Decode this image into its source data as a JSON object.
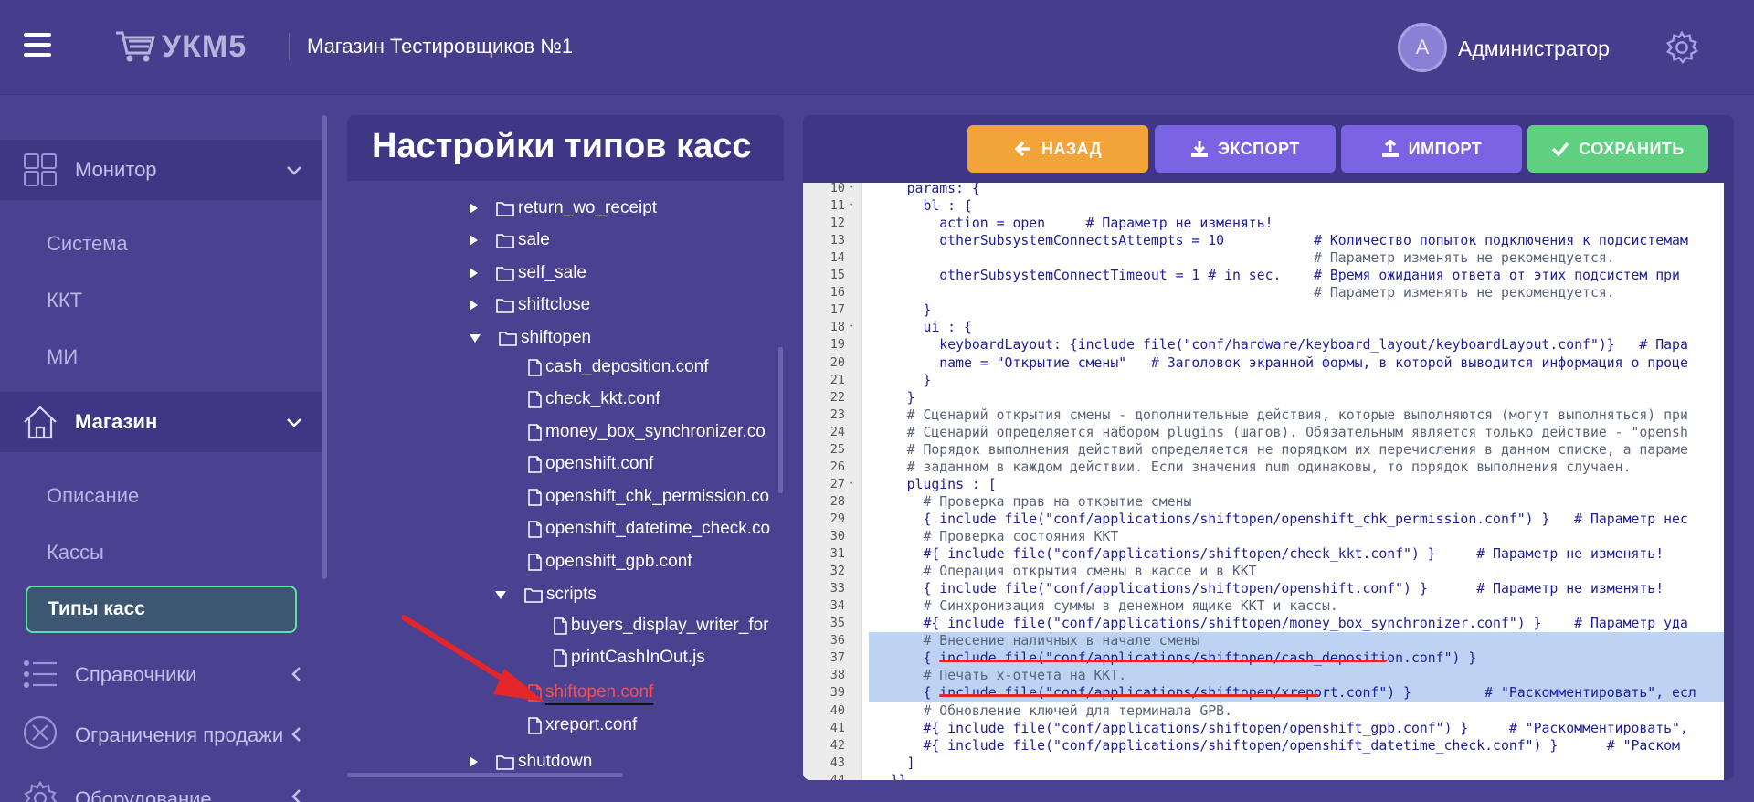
{
  "header": {
    "logo_text": "УКМ5",
    "store_name": "Магазин Тестировщиков №1",
    "avatar_letter": "А",
    "user_name": "Администратор"
  },
  "sidebar": {
    "monitor": "Монитор",
    "monitor_items": [
      "Система",
      "ККТ",
      "МИ"
    ],
    "shop": "Магазин",
    "shop_items": [
      "Описание",
      "Кассы"
    ],
    "shop_active": "Типы касс",
    "directories": "Справочники",
    "sale_limits": "Ограничения продажи",
    "equipment": "Оборудование"
  },
  "tree": {
    "title": "Настройки типов касс",
    "rows": [
      {
        "type": "folder",
        "state": "collapsed",
        "name": "return_wo_receipt"
      },
      {
        "type": "folder",
        "state": "collapsed",
        "name": "sale"
      },
      {
        "type": "folder",
        "state": "collapsed",
        "name": "self_sale"
      },
      {
        "type": "folder",
        "state": "collapsed",
        "name": "shiftclose"
      },
      {
        "type": "folder",
        "state": "expanded",
        "name": "shiftopen"
      },
      {
        "type": "file",
        "name": "cash_deposition.conf"
      },
      {
        "type": "file",
        "name": "check_kkt.conf"
      },
      {
        "type": "file",
        "name": "money_box_synchronizer.co"
      },
      {
        "type": "file",
        "name": "openshift.conf"
      },
      {
        "type": "file",
        "name": "openshift_chk_permission.co"
      },
      {
        "type": "file",
        "name": "openshift_datetime_check.co"
      },
      {
        "type": "file",
        "name": "openshift_gpb.conf"
      },
      {
        "type": "folder",
        "state": "expanded",
        "name": "scripts"
      },
      {
        "type": "file",
        "name": "buyers_display_writer_for"
      },
      {
        "type": "file",
        "name": "printCashInOut.js"
      },
      {
        "type": "file",
        "name": "shiftopen.conf",
        "highlight": true
      },
      {
        "type": "file",
        "name": "xreport.conf"
      },
      {
        "type": "folder",
        "state": "collapsed",
        "name": "shutdown"
      }
    ]
  },
  "toolbar": {
    "back": "НАЗАД",
    "export": "ЭКСПОРТ",
    "import": "ИМПОРТ",
    "save": "СОХРАНИТЬ"
  },
  "editor": {
    "lines": [
      {
        "n": "10",
        "fold": true,
        "text": "    params: {"
      },
      {
        "n": "11",
        "fold": true,
        "text": "      bl : {"
      },
      {
        "n": "12",
        "text": "        action = open     # Параметр не изменять!"
      },
      {
        "n": "13",
        "text": "        otherSubsystemConnectsAttempts = 10           # Количество попыток подключения к подсистемам"
      },
      {
        "n": "14",
        "text": "                                                      # Параметр изменять не рекомендуется."
      },
      {
        "n": "15",
        "text": "        otherSubsystemConnectTimeout = 1 # in sec.    # Время ожидания ответа от этих подсистем при"
      },
      {
        "n": "16",
        "text": "                                                      # Параметр изменять не рекомендуется."
      },
      {
        "n": "17",
        "text": "      }"
      },
      {
        "n": "18",
        "fold": true,
        "text": "      ui : {"
      },
      {
        "n": "19",
        "text": "        keyboardLayout: {include file(\"conf/hardware/keyboard_layout/keyboardLayout.conf\")}   # Пара"
      },
      {
        "n": "20",
        "text": "        name = \"Открытие смены\"   # Заголовок экранной формы, в которой выводится информация о проце"
      },
      {
        "n": "21",
        "text": "      }"
      },
      {
        "n": "22",
        "text": "    }"
      },
      {
        "n": "23",
        "text": "    # Сценарий открытия смены - дополнительные действия, которые выполняются (могут выполняться) при"
      },
      {
        "n": "24",
        "text": "    # Сценарий определяется набором plugins (шагов). Обязательным является только действие - \"opensh"
      },
      {
        "n": "25",
        "text": "    # Порядок выполнения действий определяется не порядком их перечисления в данном списке, а параме"
      },
      {
        "n": "26",
        "text": "    # заданном в каждом действии. Если значения num одинаковы, то порядок выполнения случаен."
      },
      {
        "n": "27",
        "fold": true,
        "text": "    plugins : ["
      },
      {
        "n": "28",
        "text": "      # Проверка прав на открытие смены"
      },
      {
        "n": "29",
        "text": "      { include file(\"conf/applications/shiftopen/openshift_chk_permission.conf\") }   # Параметр нес"
      },
      {
        "n": "30",
        "text": "      # Проверка состояния ККТ"
      },
      {
        "n": "31",
        "text": "      #{ include file(\"conf/applications/shiftopen/check_kkt.conf\") }     # Параметр не изменять!"
      },
      {
        "n": "32",
        "text": "      # Операция открытия смены в кассе и в ККТ"
      },
      {
        "n": "33",
        "text": "      { include file(\"conf/applications/shiftopen/openshift.conf\") }      # Параметр не изменять!"
      },
      {
        "n": "34",
        "text": "      # Синхронизация суммы в денежном ящике ККТ и кассы."
      },
      {
        "n": "35",
        "text": "      #{ include file(\"conf/applications/shiftopen/money_box_synchronizer.conf\") }    # Параметр уда"
      },
      {
        "n": "36",
        "sel": true,
        "text": "      # Внесение наличных в начале смены"
      },
      {
        "n": "37",
        "sel": true,
        "text": "      { include file(\"conf/applications/shiftopen/cash_deposition.conf\") }"
      },
      {
        "n": "38",
        "sel": true,
        "text": "      # Печать х-отчета на ККТ."
      },
      {
        "n": "39",
        "sel": true,
        "text": "      { include file(\"conf/applications/shiftopen/xreport.conf\") }         # \"Раскомментировать\", есл"
      },
      {
        "n": "40",
        "text": "      # Обновление ключей для терминала GPB."
      },
      {
        "n": "41",
        "text": "      #{ include file(\"conf/applications/shiftopen/openshift_gpb.conf\") }     # \"Раскомментировать\","
      },
      {
        "n": "42",
        "text": "      #{ include file(\"conf/applications/shiftopen/openshift_datetime_check.conf\") }      # \"Раском"
      },
      {
        "n": "43",
        "text": "    ]"
      },
      {
        "n": "44",
        "text": "  }}"
      }
    ]
  },
  "colors": {
    "accent_back": "#f2a33a",
    "accent_export": "#7b64e3",
    "accent_save": "#5fcf80",
    "highlight_file": "#ff4d4d",
    "annotation_red": "#e3262a"
  }
}
